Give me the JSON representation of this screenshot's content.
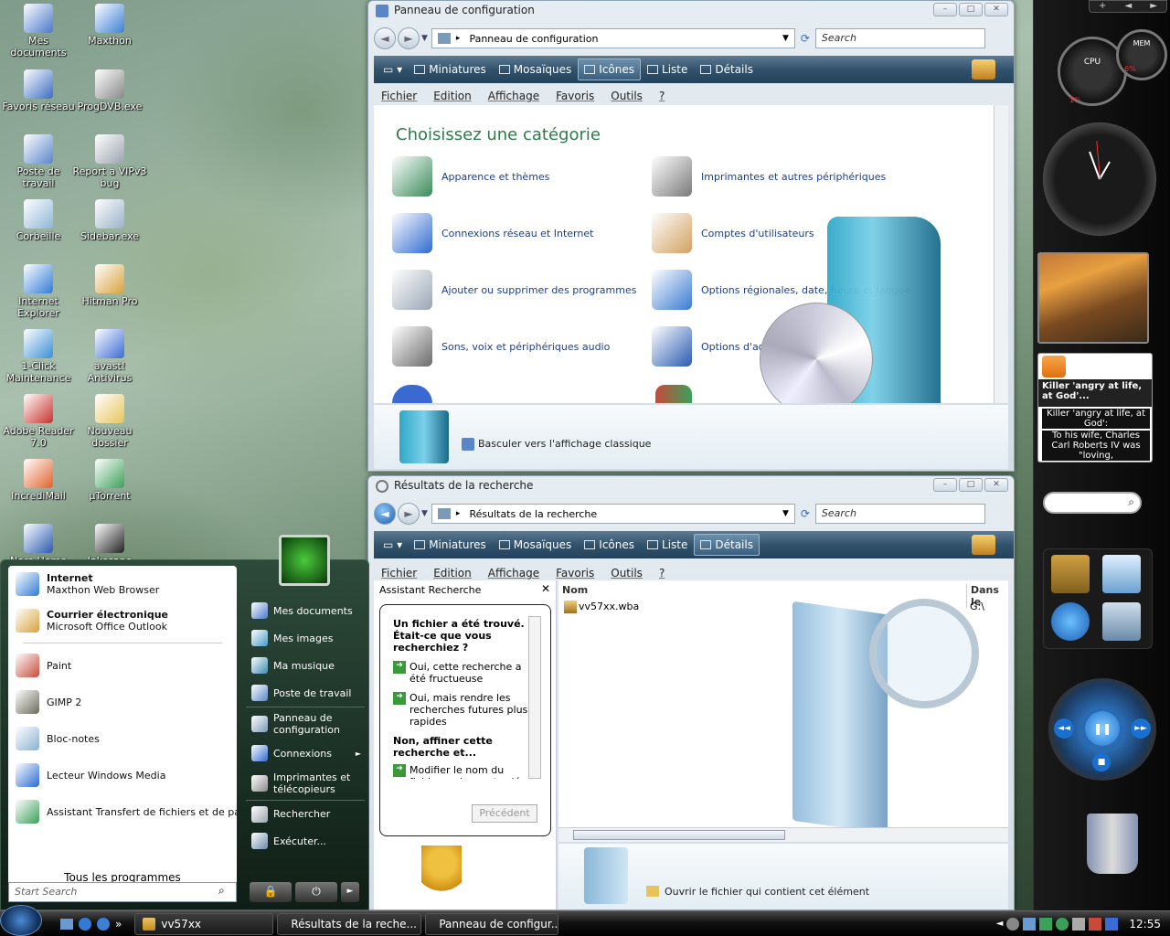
{
  "desktop_icons": [
    {
      "label": "Mes documents",
      "color": "#4a78c8"
    },
    {
      "label": "Maxthon",
      "color": "#3c7fd6"
    },
    {
      "label": "Favoris réseau",
      "color": "#3a6dc0"
    },
    {
      "label": "ProgDVB.exe",
      "color": "#888888"
    },
    {
      "label": "Poste de travail",
      "color": "#5a86c8"
    },
    {
      "label": "Report a VIPv3 bug",
      "color": "#9aa4ad"
    },
    {
      "label": "Corbeille",
      "color": "#8fb6d6"
    },
    {
      "label": "Sidebar.exe",
      "color": "#9ab0c8"
    },
    {
      "label": "Internet Explorer",
      "color": "#2f7bd6"
    },
    {
      "label": "Hitman Pro",
      "color": "#d6a23a"
    },
    {
      "label": "1-Click Maintenance",
      "color": "#3a8fd6"
    },
    {
      "label": "avast! Antivirus",
      "color": "#3a6ad6"
    },
    {
      "label": "Adobe Reader 7.0",
      "color": "#c8302a"
    },
    {
      "label": "Nouveau dossier",
      "color": "#e7c45a"
    },
    {
      "label": "IncrediMail",
      "color": "#e0622a"
    },
    {
      "label": "µTorrent",
      "color": "#3aa05a"
    },
    {
      "label": "Nero Home",
      "color": "#2a5ab0"
    },
    {
      "label": "Inkscape",
      "color": "#222222"
    }
  ],
  "control_panel": {
    "title": "Panneau de configuration",
    "address": "Panneau de configuration",
    "search_placeholder": "Search",
    "toolbar": [
      "Miniatures",
      "Mosaïques",
      "Icônes",
      "Liste",
      "Détails"
    ],
    "selected_view": "Icônes",
    "menu": [
      "Fichier",
      "Edition",
      "Affichage",
      "Favoris",
      "Outils",
      "?"
    ],
    "heading": "Choisissez une catégorie",
    "categories": [
      {
        "label": "Apparence et thèmes",
        "color": "#3a8a5a"
      },
      {
        "label": "Imprimantes et autres périphériques",
        "color": "#7a7a7a"
      },
      {
        "label": "Connexions réseau et Internet",
        "color": "#2f6ad0"
      },
      {
        "label": "Comptes d'utilisateurs",
        "color": "#d2a060"
      },
      {
        "label": "Ajouter ou supprimer des programmes",
        "color": "#9aa6b4"
      },
      {
        "label": "Options régionales, date, heure et langue",
        "color": "#3a7ad0"
      },
      {
        "label": "Sons, voix et périphériques audio",
        "color": "#6a6a6a"
      },
      {
        "label": "Options d'accessibilité",
        "color": "#2a5ab0"
      }
    ],
    "bottom_link": "Basculer vers l'affichage classique"
  },
  "search_results": {
    "title": "Résultats de la recherche",
    "address": "Résultats de la recherche",
    "search_placeholder": "Search",
    "toolbar": [
      "Miniatures",
      "Mosaïques",
      "Icônes",
      "Liste",
      "Détails"
    ],
    "selected_view": "Détails",
    "menu": [
      "Fichier",
      "Edition",
      "Affichage",
      "Favoris",
      "Outils",
      "?"
    ],
    "assistant_title": "Assistant Recherche",
    "found_text": "Un fichier a été trouvé. Était-ce que vous recherchiez ?",
    "opt1": "Oui, cette recherche a été fructueuse",
    "opt2": "Oui, mais rendre les recherches futures plus rapides",
    "refine_text": "Non, affiner cette recherche et...",
    "opt3": "Modifier le nom du fichier ou les mots-clés",
    "prev_button": "Précédent",
    "col_name": "Nom",
    "col_in": "Dans le",
    "file_name": "vv57xx.wba",
    "file_location": "G:\\",
    "open_link": "Ouvrir le fichier qui contient cet élément"
  },
  "start_menu": {
    "pinned": [
      {
        "title": "Internet",
        "sub": "Maxthon Web Browser",
        "color": "#2f7bd6"
      },
      {
        "title": "Courrier électronique",
        "sub": "Microsoft Office Outlook",
        "color": "#d6a23a"
      }
    ],
    "recent": [
      {
        "title": "Paint",
        "color": "#c84a3a"
      },
      {
        "title": "GIMP 2",
        "color": "#6a6a5a"
      },
      {
        "title": "Bloc-notes",
        "color": "#8ab0d0"
      },
      {
        "title": "Lecteur Windows Media",
        "color": "#2a6ad6"
      },
      {
        "title": "Assistant Transfert de fichiers et de paramètres",
        "color": "#3aa05a"
      }
    ],
    "all_programs": "Tous les programmes",
    "search_placeholder": "Start Search",
    "right_items": [
      {
        "label": "Mes documents",
        "color": "#4a78c8"
      },
      {
        "label": "Mes images",
        "color": "#4a9ac8"
      },
      {
        "label": "Ma musique",
        "color": "#3a8ab0"
      },
      {
        "label": "Poste de travail",
        "color": "#5a86c8"
      },
      {
        "label": "Panneau de configuration",
        "color": "#7a9ab8"
      },
      {
        "label": "Connexions",
        "color": "#2f6ad0"
      },
      {
        "label": "Imprimantes et télécopieurs",
        "color": "#8a8a8a"
      },
      {
        "label": "Rechercher",
        "color": "#9aa4ad"
      },
      {
        "label": "Exécuter...",
        "color": "#6a8aaa"
      }
    ],
    "connexions_arrow": "►"
  },
  "sidebar": {
    "cpu_label": "CPU",
    "cpu_value": "1%",
    "mem_label": "MEM",
    "mem_value": "6%",
    "feed_headline": "Killer 'angry at life, at God'...",
    "feed_body1": "Killer 'angry at life, at God':",
    "feed_body2": "To his wife, Charles Carl Roberts IV was \"loving,"
  },
  "taskbar": {
    "tasks": [
      "vv57xx",
      "Résultats de la reche...",
      "Panneau de configur..."
    ],
    "clock": "12:55",
    "overflow": "»"
  }
}
